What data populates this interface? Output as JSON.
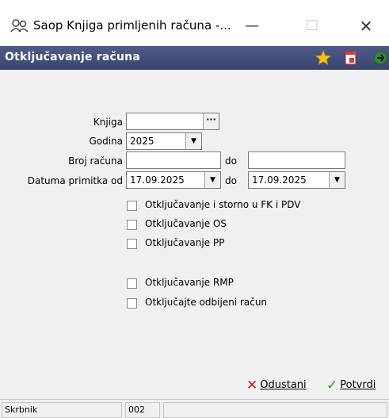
{
  "window": {
    "title": "Saop Knjiga primljenih računa -...",
    "minimize": "—",
    "maximize": "☐",
    "close": "✕"
  },
  "header": {
    "title": "Otključavanje računa"
  },
  "form": {
    "knjiga_label": "Knjiga",
    "knjiga_value": "",
    "knjiga_button": "···",
    "godina_label": "Godina",
    "godina_value": "2025",
    "broj_label": "Broj računa",
    "broj_from": "",
    "broj_do": "do",
    "broj_to": "",
    "datum_label": "Datuma primitka od",
    "datum_from": "17.09.2025",
    "datum_do": "do",
    "datum_to": "17.09.2025",
    "checkboxes": [
      "Otključavanje i storno u FK i PDV",
      "Otključavanje OS",
      "Otključavanje PP",
      "Otključavanje RMP",
      "Otključajte odbijeni račun"
    ]
  },
  "actions": {
    "cancel": "Odustani",
    "confirm": "Potvrdi"
  },
  "statusbar": {
    "user_label": "Skrbnik",
    "code": "002",
    "info": ""
  },
  "colors": {
    "header_bg": "#434d7a",
    "cancel_icon": "#d11a1a",
    "confirm_icon": "#2a9a2a"
  }
}
